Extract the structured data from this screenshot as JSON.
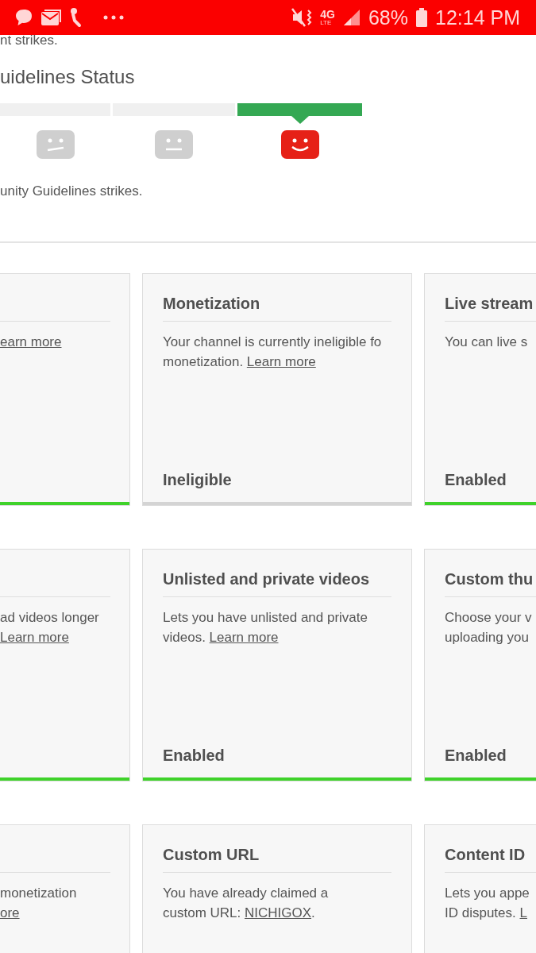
{
  "status_bar": {
    "network": "4G",
    "network_sub": "LTE",
    "battery": "68%",
    "time": "12:14 PM"
  },
  "copyright_text": "nt strikes.",
  "guidelines": {
    "title": "uidelines Status",
    "segments": [
      {
        "kind": "skeptical",
        "selected": false
      },
      {
        "kind": "neutral",
        "selected": false
      },
      {
        "kind": "happy",
        "selected": true
      }
    ],
    "note": "unity Guidelines strikes."
  },
  "card_rows": [
    [
      {
        "kind": "left",
        "enabled": true,
        "lines": [
          [
            {
              "text": "earn more",
              "link": true
            }
          ]
        ]
      },
      {
        "kind": "middle",
        "title": "Monetization",
        "enabled": false,
        "status": "Ineligible",
        "lines": [
          [
            {
              "text": "Your channel is currently ineligible fo"
            }
          ],
          [
            {
              "text": "monetization. "
            },
            {
              "text": "Learn more",
              "link": true
            }
          ]
        ]
      },
      {
        "kind": "right",
        "title": "Live stream",
        "enabled": true,
        "status": "Enabled",
        "lines": [
          [
            {
              "text": "You can live s"
            }
          ]
        ]
      }
    ],
    [
      {
        "kind": "left",
        "enabled": true,
        "lines": [
          [
            {
              "text": "ad videos longer"
            }
          ],
          [
            {
              "text": "Learn more",
              "link": true
            }
          ]
        ]
      },
      {
        "kind": "middle",
        "title": "Unlisted and private videos",
        "enabled": true,
        "status": "Enabled",
        "lines": [
          [
            {
              "text": "Lets you have unlisted and private"
            }
          ],
          [
            {
              "text": "videos. "
            },
            {
              "text": "Learn more",
              "link": true
            }
          ]
        ]
      },
      {
        "kind": "right",
        "title": "Custom thu",
        "enabled": true,
        "status": "Enabled",
        "lines": [
          [
            {
              "text": "Choose your v"
            }
          ],
          [
            {
              "text": "uploading you"
            }
          ]
        ]
      }
    ],
    [
      {
        "kind": "left",
        "lines": [
          [
            {
              "text": "monetization"
            }
          ],
          [
            {
              "text": "ore",
              "link": true
            }
          ]
        ]
      },
      {
        "kind": "middle",
        "title": "Custom URL",
        "lines": [
          [
            {
              "text": "You have already claimed a"
            }
          ],
          [
            {
              "text": "custom URL: "
            },
            {
              "text": "NICHIGOX",
              "link": true
            },
            {
              "text": "."
            }
          ]
        ]
      },
      {
        "kind": "right",
        "title": "Content ID",
        "lines": [
          [
            {
              "text": "Lets you appe"
            }
          ],
          [
            {
              "text": "ID disputes. "
            },
            {
              "text": "L",
              "link": true
            }
          ]
        ]
      }
    ]
  ]
}
